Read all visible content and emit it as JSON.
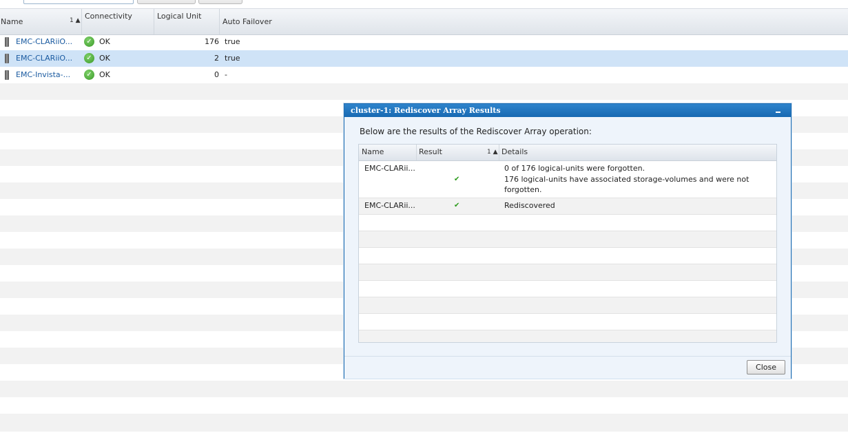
{
  "table": {
    "columns": {
      "name": "Name",
      "name_sort": "1",
      "connectivity": "Connectivity",
      "logical_unit": "Logical Unit",
      "auto_failover": "Auto Failover"
    },
    "rows": [
      {
        "name": "EMC-CLARiiO...",
        "connectivity": "OK",
        "logical_unit": "176",
        "auto_failover": "true"
      },
      {
        "name": "EMC-CLARiiO...",
        "connectivity": "OK",
        "logical_unit": "2",
        "auto_failover": "true"
      },
      {
        "name": "EMC-Invista-...",
        "connectivity": "OK",
        "logical_unit": "0",
        "auto_failover": "-"
      }
    ]
  },
  "dialog": {
    "title": "cluster-1: Rediscover Array Results",
    "intro": "Below are the results of the Rediscover Array operation:",
    "columns": {
      "name": "Name",
      "result": "Result",
      "result_sort": "1",
      "details": "Details"
    },
    "rows": [
      {
        "name": "EMC-CLARii...",
        "result": "✔",
        "details_line1": "0 of 176 logical-units were forgotten.",
        "details_line2": "176 logical-units have associated storage-volumes and were not",
        "details_line3": "forgotten."
      },
      {
        "name": "EMC-CLARii...",
        "result": "✔",
        "details_line1": "Rediscovered"
      }
    ],
    "close_label": "Close"
  },
  "icons": {
    "device": "storage-array-icon",
    "status_ok": "ok-check-icon",
    "sort_asc": "sort-ascending-icon",
    "minimize": "minimize-icon"
  },
  "colors": {
    "dialog_title_bg": "#1769b2",
    "selected_row": "#cfe3f7",
    "link": "#1a5aa0",
    "ok_green": "#3a9a28"
  }
}
